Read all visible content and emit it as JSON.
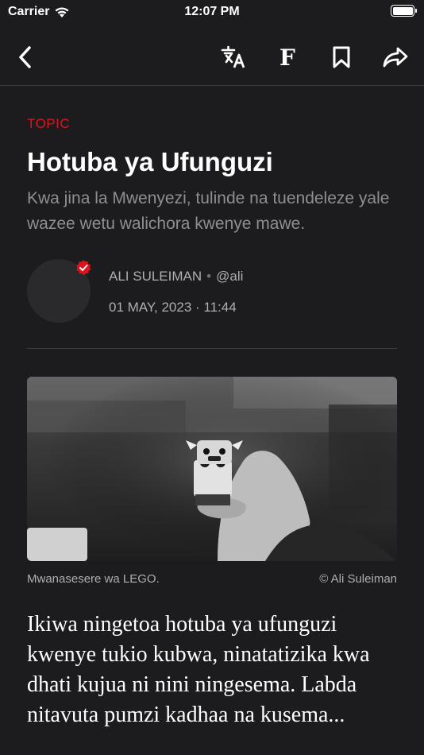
{
  "status_bar": {
    "carrier": "Carrier",
    "time": "12:07 PM"
  },
  "nav": {
    "icons": [
      "chevron-left-icon",
      "translate-icon",
      "font-icon",
      "bookmark-icon",
      "share-icon"
    ],
    "font_label": "F"
  },
  "article": {
    "topic": "TOPIC",
    "title": "Hotuba ya Ufunguzi",
    "subtitle": "Kwa jina la Mwenyezi, tulinde na tuendeleze yale wazee wetu walichora kwenye mawe.",
    "author": {
      "name": "ALI SULEIMAN",
      "separator": "•",
      "handle": "@ali",
      "date": "01 MAY, 2023 · 11:44",
      "verified": true
    },
    "image": {
      "caption": "Mwanasesere wa LEGO.",
      "credit": "© Ali Suleiman"
    },
    "body": "Ikiwa ningetoa hotuba ya ufunguzi kwenye tukio kubwa, ninatatizika kwa dhati kujua ni nini ningesema. Labda nitavuta pumzi kadhaa na kusema..."
  },
  "colors": {
    "background": "#1c1c1e",
    "accent": "#e0131d",
    "secondary_text": "#8e8e93"
  }
}
